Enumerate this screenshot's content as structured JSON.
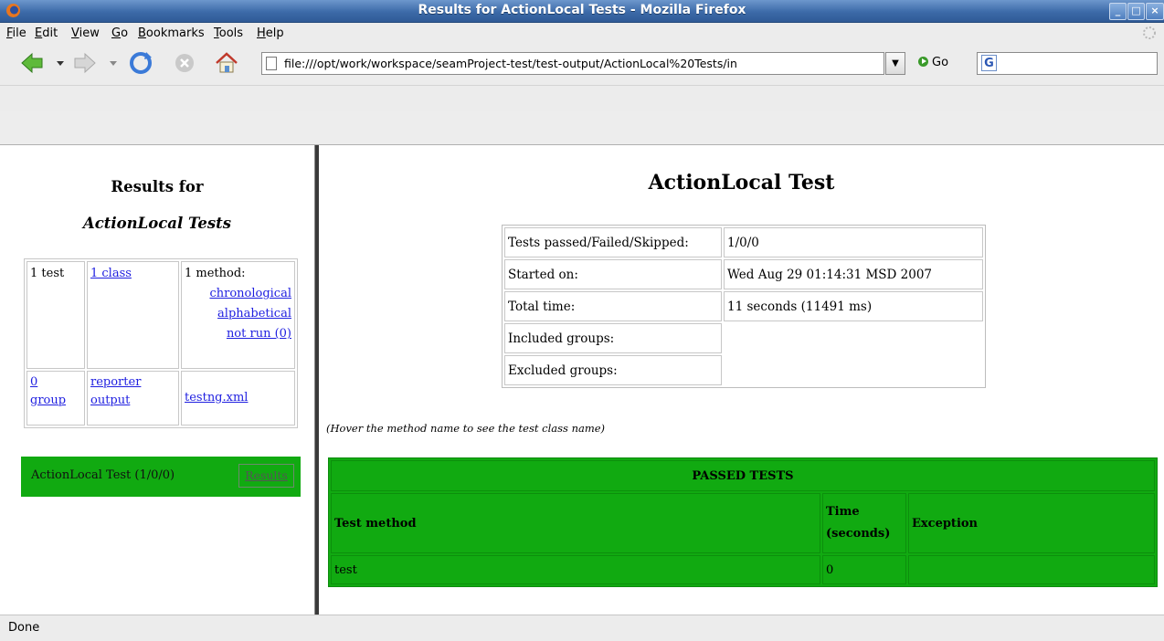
{
  "window": {
    "title": "Results for ActionLocal Tests - Mozilla Firefox",
    "controls": [
      "_",
      "□",
      "×"
    ]
  },
  "menubar": {
    "items": [
      "File",
      "Edit",
      "View",
      "Go",
      "Bookmarks",
      "Tools",
      "Help"
    ]
  },
  "navbar": {
    "url": "file:///opt/work/workspace/seamProject-test/test-output/ActionLocal%20Tests/in",
    "go_label": "Go",
    "search_engine_glyph": "G"
  },
  "left_frame": {
    "heading_line1": "Results for",
    "heading_line2": "ActionLocal Tests",
    "summary": {
      "test_count": "1 test",
      "class_link": "1 class",
      "method_label": "1 method:",
      "chronological_link": "chronological",
      "alphabetical_link": "alphabetical",
      "not_run_link": "not run (0)",
      "group_link_number": "0",
      "group_link_word": "group",
      "reporter_link_line1": "reporter",
      "reporter_link_line2": "output",
      "testng_link": "testng.xml"
    },
    "test_entry": {
      "name": "ActionLocal Test (1/0/0)",
      "results_link": "Results"
    }
  },
  "right_frame": {
    "title": "ActionLocal Test",
    "info_rows": [
      {
        "label": "Tests passed/Failed/Skipped:",
        "value": "1/0/0"
      },
      {
        "label": "Started on:",
        "value": "Wed Aug 29 01:14:31 MSD 2007"
      },
      {
        "label": "Total time:",
        "value": "11 seconds (11491 ms)"
      },
      {
        "label": "Included groups:",
        "value": ""
      },
      {
        "label": "Excluded groups:",
        "value": ""
      }
    ],
    "hover_note": "(Hover the method name to see the test class name)",
    "passed_tests": {
      "title": "PASSED TESTS",
      "columns": {
        "method": "Test method",
        "time_line1": "Time",
        "time_line2": "(seconds)",
        "exception": "Exception"
      },
      "rows": [
        {
          "method": "test",
          "time": "0",
          "exception": ""
        }
      ]
    }
  },
  "status": {
    "text": "Done"
  },
  "colors": {
    "passed_green": "#11aa11",
    "link_blue": "#1e1ee0",
    "titlebar_blue": "#3c6aa8"
  }
}
